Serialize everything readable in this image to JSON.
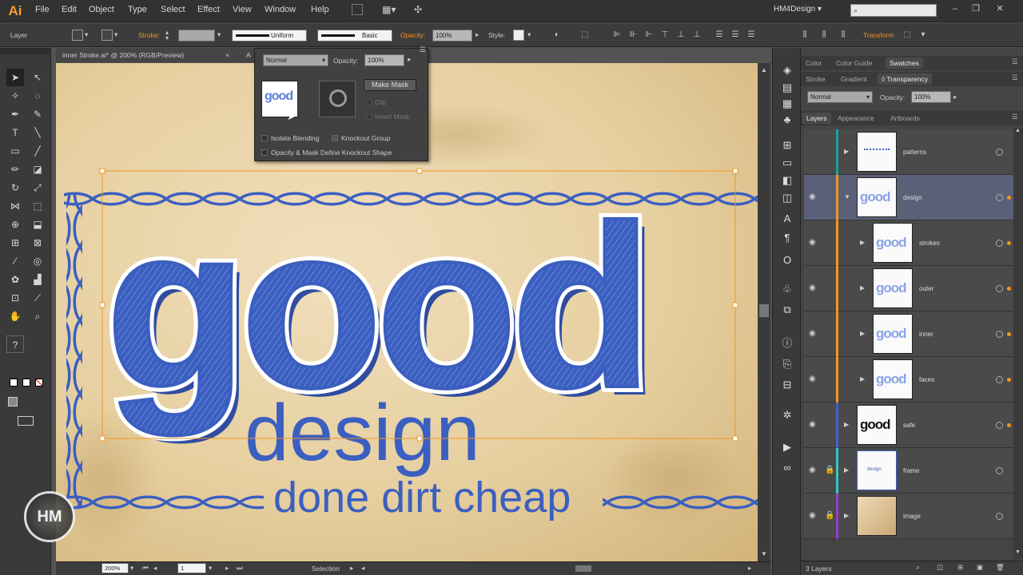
{
  "app": {
    "logo": "Ai",
    "workspace": "HM4Design ▾"
  },
  "menu": [
    "File",
    "Edit",
    "Object",
    "Type",
    "Select",
    "Effect",
    "View",
    "Window",
    "Help"
  ],
  "control": {
    "selection_type": "Layer",
    "stroke_label": "Stroke:",
    "profile": "Uniform",
    "brush": "Basic",
    "opacity_label": "Opacity:",
    "opacity_value": "100%",
    "style_label": "Style:",
    "transform_label": "Transform"
  },
  "document": {
    "tab": "inner Stroke.ai* @ 200% (RGB/Preview)",
    "close": "×",
    "tab2": "A"
  },
  "transparency_popup": {
    "blend_mode": "Normal",
    "opacity_label": "Opacity:",
    "opacity_value": "100%",
    "make_mask": "Make Mask",
    "clip": "Clip",
    "invert_mask": "Invert Mask",
    "isolate_blending": "Isolate Blending",
    "knockout_group": "Knockout Group",
    "opacity_mask_knockout": "Opacity & Mask Define Knockout Shape"
  },
  "artwork": {
    "headline": "good",
    "subhead": "design",
    "tagline": "done dirt cheap",
    "watermark": "HM",
    "colors": {
      "blue": "#3b5fc0",
      "paper": "#ead6ae"
    }
  },
  "status": {
    "zoom": "200%",
    "artboard": "1",
    "tool": "Selection"
  },
  "right_panel": {
    "top_tabs": [
      "Color",
      "Color Guide",
      "Swatches"
    ],
    "mid_tabs": [
      "Stroke",
      "Gradient",
      "◊ Transparency"
    ],
    "blend_mode": "Normal",
    "opacity_label": "Opacity:",
    "opacity_value": "100%",
    "layer_tabs": [
      "Layers",
      "Appearance",
      "Artboards"
    ],
    "layers": [
      {
        "name": "patterns",
        "color": "#1aa2a2",
        "thumb": "pattern",
        "indent": 0,
        "expanded": false,
        "lock": false
      },
      {
        "name": "design",
        "color": "#f29624",
        "thumb": "good",
        "indent": 0,
        "expanded": true,
        "lock": false,
        "selected": true
      },
      {
        "name": "strokes",
        "color": "#f29624",
        "thumb": "good",
        "indent": 1,
        "expanded": false,
        "lock": false
      },
      {
        "name": "outer",
        "color": "#f29624",
        "thumb": "good",
        "indent": 1,
        "expanded": false,
        "lock": false
      },
      {
        "name": "inner",
        "color": "#f29624",
        "thumb": "good",
        "indent": 1,
        "expanded": false,
        "lock": false
      },
      {
        "name": "faces",
        "color": "#f29624",
        "thumb": "good",
        "indent": 1,
        "expanded": false,
        "lock": false
      },
      {
        "name": "safe",
        "color": "#4a5ec8",
        "thumb": "good-black",
        "indent": 0,
        "expanded": false,
        "lock": false
      },
      {
        "name": "frame",
        "color": "#2ec8c8",
        "thumb": "design",
        "indent": 0,
        "expanded": false,
        "lock": true
      },
      {
        "name": "image",
        "color": "#9a3ad0",
        "thumb": "tan",
        "indent": 0,
        "expanded": false,
        "lock": true
      }
    ],
    "layers_count": "3 Layers"
  }
}
